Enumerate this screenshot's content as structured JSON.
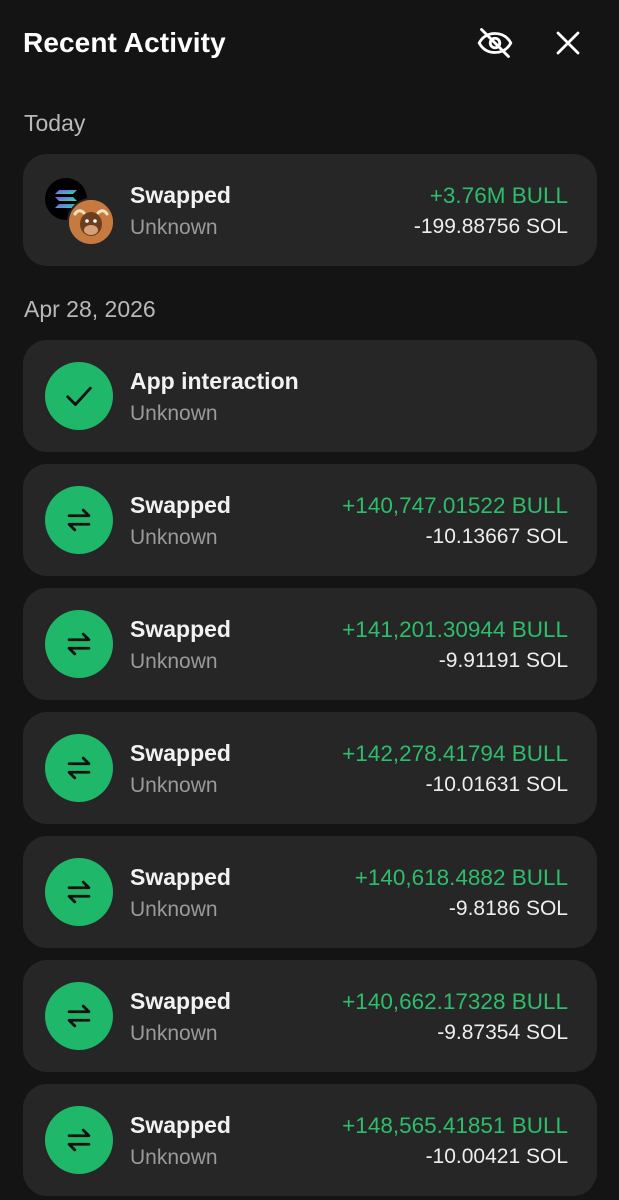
{
  "header": {
    "title": "Recent Activity",
    "hide_icon": "eye-off-icon",
    "close_icon": "close-icon"
  },
  "colors": {
    "background": "#141414",
    "card": "#262626",
    "accent_green": "#2ebd6b",
    "icon_green": "#1fb86a"
  },
  "groups": [
    {
      "label": "Today",
      "items": [
        {
          "type": "swap-token-pair",
          "title": "Swapped",
          "subtitle": "Unknown",
          "amount_in": "+3.76M BULL",
          "amount_out": "-199.88756 SOL",
          "icons": [
            "solana-token-icon",
            "bull-token-icon"
          ]
        }
      ]
    },
    {
      "label": "Apr 28, 2026",
      "items": [
        {
          "type": "app-interaction",
          "title": "App interaction",
          "subtitle": "Unknown",
          "icon": "checkmark-icon"
        },
        {
          "type": "swap",
          "title": "Swapped",
          "subtitle": "Unknown",
          "amount_in": "+140,747.01522 BULL",
          "amount_out": "-10.13667 SOL",
          "icon": "swap-arrows-icon"
        },
        {
          "type": "swap",
          "title": "Swapped",
          "subtitle": "Unknown",
          "amount_in": "+141,201.30944 BULL",
          "amount_out": "-9.91191 SOL",
          "icon": "swap-arrows-icon"
        },
        {
          "type": "swap",
          "title": "Swapped",
          "subtitle": "Unknown",
          "amount_in": "+142,278.41794 BULL",
          "amount_out": "-10.01631 SOL",
          "icon": "swap-arrows-icon"
        },
        {
          "type": "swap",
          "title": "Swapped",
          "subtitle": "Unknown",
          "amount_in": "+140,618.4882 BULL",
          "amount_out": "-9.8186 SOL",
          "icon": "swap-arrows-icon"
        },
        {
          "type": "swap",
          "title": "Swapped",
          "subtitle": "Unknown",
          "amount_in": "+140,662.17328 BULL",
          "amount_out": "-9.87354 SOL",
          "icon": "swap-arrows-icon"
        },
        {
          "type": "swap",
          "title": "Swapped",
          "subtitle": "Unknown",
          "amount_in": "+148,565.41851 BULL",
          "amount_out": "-10.00421 SOL",
          "icon": "swap-arrows-icon"
        }
      ]
    }
  ]
}
